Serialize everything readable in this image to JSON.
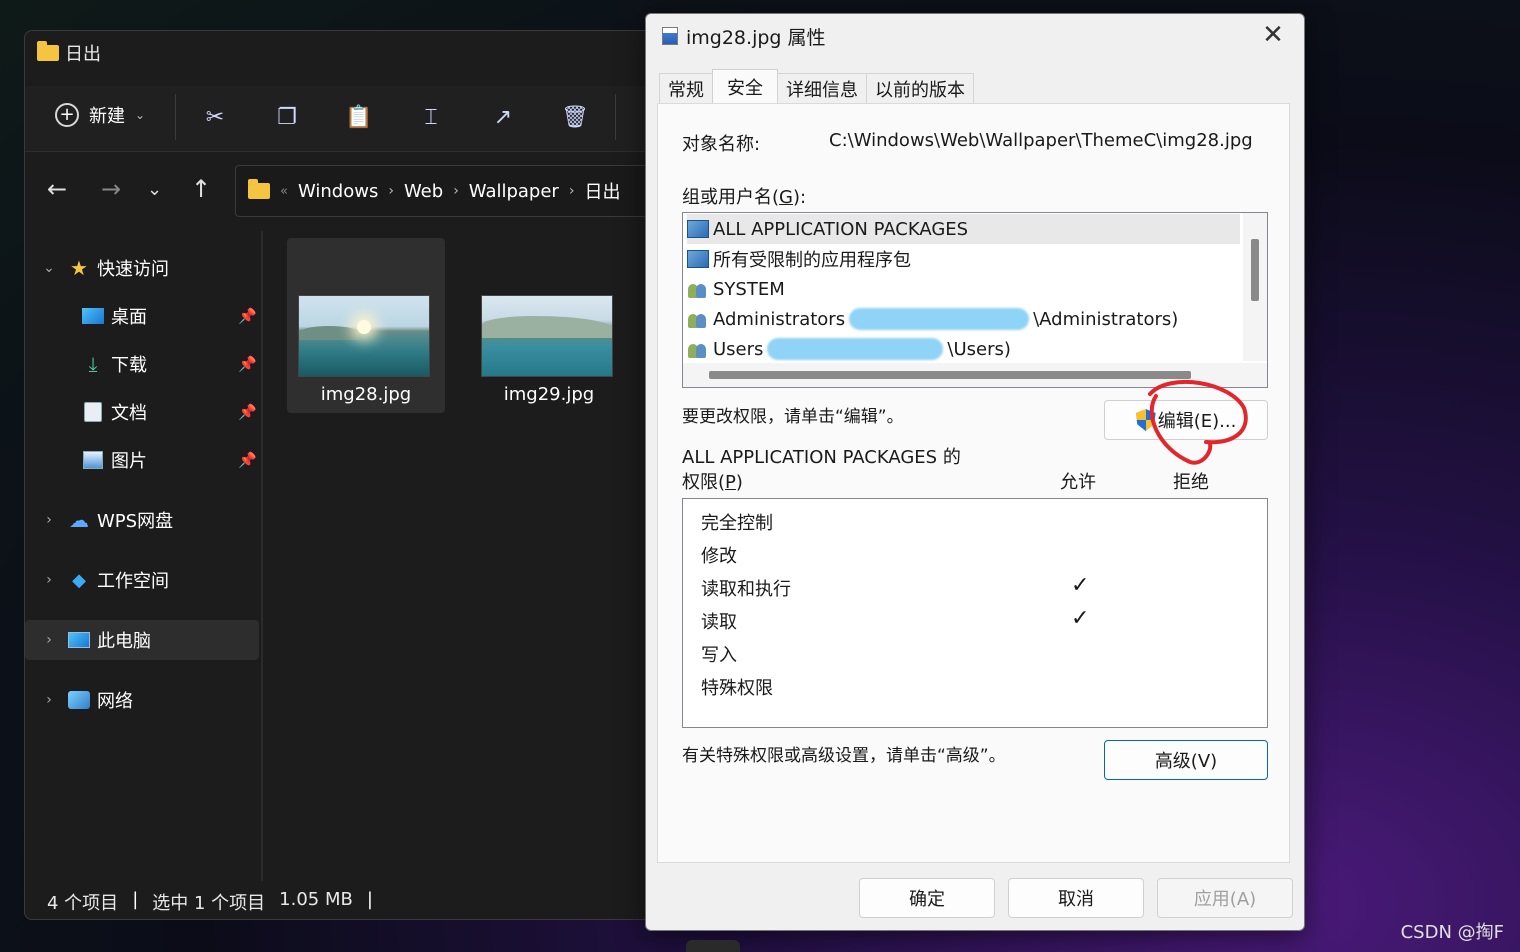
{
  "explorer": {
    "title": "日出",
    "toolbar": {
      "new_label": "新建",
      "new_icon": "plus-circle-icon"
    },
    "address": {
      "crumbs": [
        "Windows",
        "Web",
        "Wallpaper",
        "日出"
      ],
      "overflow": "«"
    },
    "sidebar": {
      "quick_access": "快速访问",
      "desktop": "桌面",
      "downloads": "下载",
      "documents": "文档",
      "pictures": "图片",
      "wps": "WPS网盘",
      "workspace": "工作空间",
      "this_pc": "此电脑",
      "network": "网络"
    },
    "files": [
      {
        "name": "img28.jpg",
        "selected": true
      },
      {
        "name": "img29.jpg",
        "selected": false
      }
    ],
    "status": {
      "count": "4 个项目",
      "selected": "选中 1 个项目",
      "size": "1.05 MB",
      "sep": "|"
    }
  },
  "dialog": {
    "title": "img28.jpg 属性",
    "tabs": [
      "常规",
      "安全",
      "详细信息",
      "以前的版本"
    ],
    "active_tab": "安全",
    "object_name_label": "对象名称:",
    "object_name_value": "C:\\Windows\\Web\\Wallpaper\\ThemeC\\img28.jpg",
    "groups_label": "组或用户名(G):",
    "groups": [
      {
        "name": "ALL APPLICATION PACKAGES",
        "icon": "package-icon",
        "suffix": ""
      },
      {
        "name": "所有受限制的应用程序包",
        "icon": "package-icon",
        "suffix": ""
      },
      {
        "name": "SYSTEM",
        "icon": "users-icon",
        "suffix": ""
      },
      {
        "name": "Administrators",
        "icon": "users-icon",
        "suffix": "\\Administrators)"
      },
      {
        "name": "Users",
        "icon": "users-icon",
        "suffix": "\\Users)"
      }
    ],
    "edit_hint": "要更改权限，请单击“编辑”。",
    "edit_button": "编辑(E)...",
    "perm_for": "ALL APPLICATION PACKAGES 的",
    "perm_label": "权限(P)",
    "allow_header": "允许",
    "deny_header": "拒绝",
    "permissions": [
      {
        "name": "完全控制",
        "allow": false,
        "deny": false
      },
      {
        "name": "修改",
        "allow": false,
        "deny": false
      },
      {
        "name": "读取和执行",
        "allow": true,
        "deny": false
      },
      {
        "name": "读取",
        "allow": true,
        "deny": false
      },
      {
        "name": "写入",
        "allow": false,
        "deny": false
      },
      {
        "name": "特殊权限",
        "allow": false,
        "deny": false
      }
    ],
    "check_mark": "✓",
    "advanced_hint": "有关特殊权限或高级设置，请单击“高级”。",
    "advanced_button": "高级(V)",
    "ok_button": "确定",
    "cancel_button": "取消",
    "apply_button": "应用(A)",
    "close_glyph": "✕"
  },
  "watermark": "CSDN @掏F",
  "colors": {
    "annotation_red": "#e3262b",
    "accent": "#0067c0"
  }
}
